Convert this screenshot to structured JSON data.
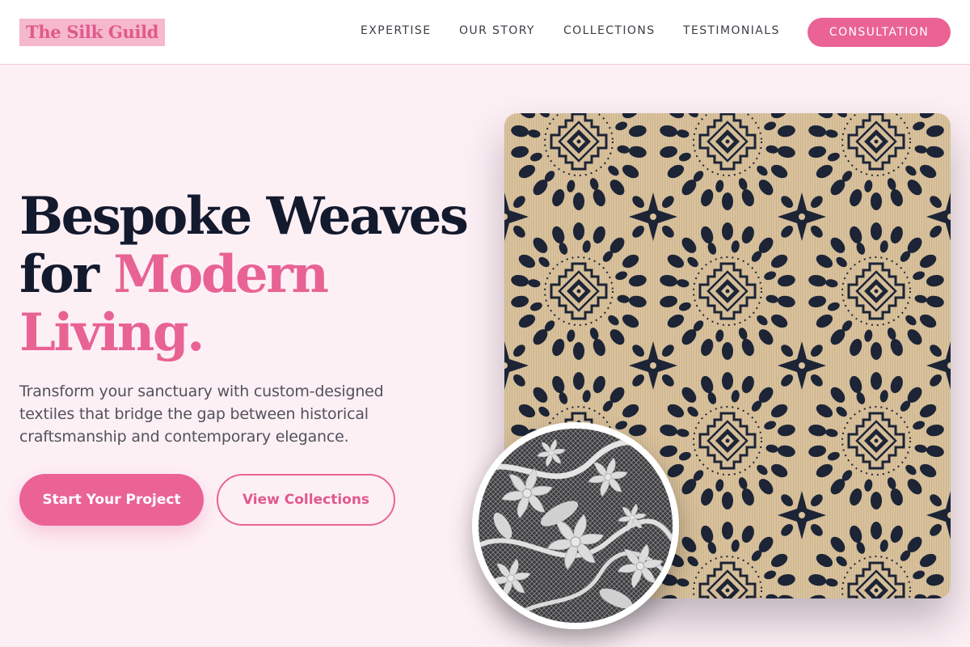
{
  "brand": {
    "name": "The Silk Guild"
  },
  "nav": {
    "links": [
      "EXPERTISE",
      "OUR STORY",
      "COLLECTIONS",
      "TESTIMONIALS"
    ],
    "cta_label": "CONSULTATION"
  },
  "hero": {
    "headline_line1": "Bespoke Weaves",
    "headline_line2_prefix": "for ",
    "headline_line2_accent": "Modern",
    "headline_line3_accent": "Living.",
    "description": "Transform your sanctuary with custom-designed textiles that bridge the gap between historical craftsmanship and contemporary elegance.",
    "primary_button": "Start Your Project",
    "secondary_button": "View Collections"
  },
  "images": {
    "main": "navy-damask-medallion-fabric",
    "inset": "white-lace-fabric-closeup"
  },
  "colors": {
    "accent": "#ea6394",
    "heading": "#141a2e",
    "background": "#fdf0f5",
    "fabric_ground": "#d8c09a",
    "fabric_ink": "#1c2436"
  }
}
